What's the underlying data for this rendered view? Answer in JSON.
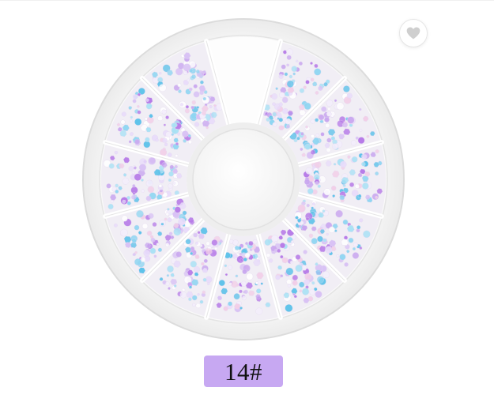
{
  "product": {
    "variant_label": "14#"
  },
  "wishlist": {
    "icon": "heart-icon"
  },
  "colors": {
    "label_background": "#c7a8f2",
    "heart": "#cfcfcf",
    "tray": "#f7f7f7",
    "hub": "#fbfbfb"
  }
}
